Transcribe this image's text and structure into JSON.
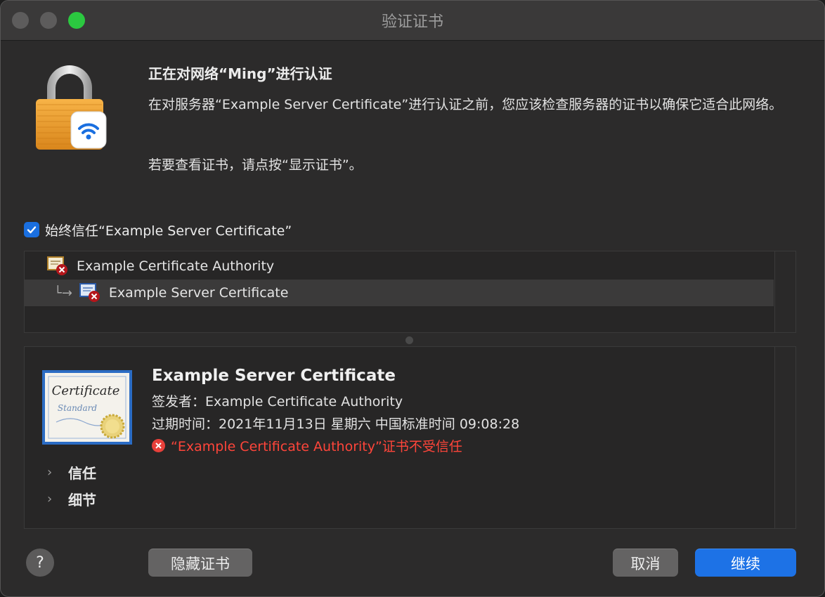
{
  "window": {
    "title": "验证证书"
  },
  "message": {
    "heading": "正在对网络“Ming”进行认证",
    "description": "在对服务器“Example Server Certificate”进行认证之前，您应该检查服务器的证书以确保它适合此网络。",
    "hint": "若要查看证书，请点按“显示证书”。"
  },
  "trust_checkbox": {
    "label": "始终信任“Example Server Certificate”",
    "checked": true
  },
  "cert_tree": {
    "items": [
      {
        "label": "Example Certificate Authority"
      },
      {
        "label": "Example Server Certificate",
        "selected": true
      }
    ]
  },
  "cert_detail": {
    "title": "Example Server Certificate",
    "issuer": "签发者：Example Certificate Authority",
    "expiry": "过期时间：2021年11月13日 星期六 中国标准时间 09:08:28",
    "error": "“Example Certificate Authority”证书不受信任",
    "icon_text_main": "Certificate",
    "icon_text_sub": "Standard",
    "sections": [
      {
        "label": "信任"
      },
      {
        "label": "细节"
      }
    ]
  },
  "buttons": {
    "help": "?",
    "hide_cert": "隐藏证书",
    "cancel": "取消",
    "continue": "继续"
  },
  "colors": {
    "accent": "#1d72e6",
    "error": "#ff453a",
    "zoom_light": "#2bc840"
  },
  "icons": {
    "lock": "lock-wifi-icon",
    "cert_error": "certificate-error-icon",
    "chevron": "chevron-right-icon"
  }
}
